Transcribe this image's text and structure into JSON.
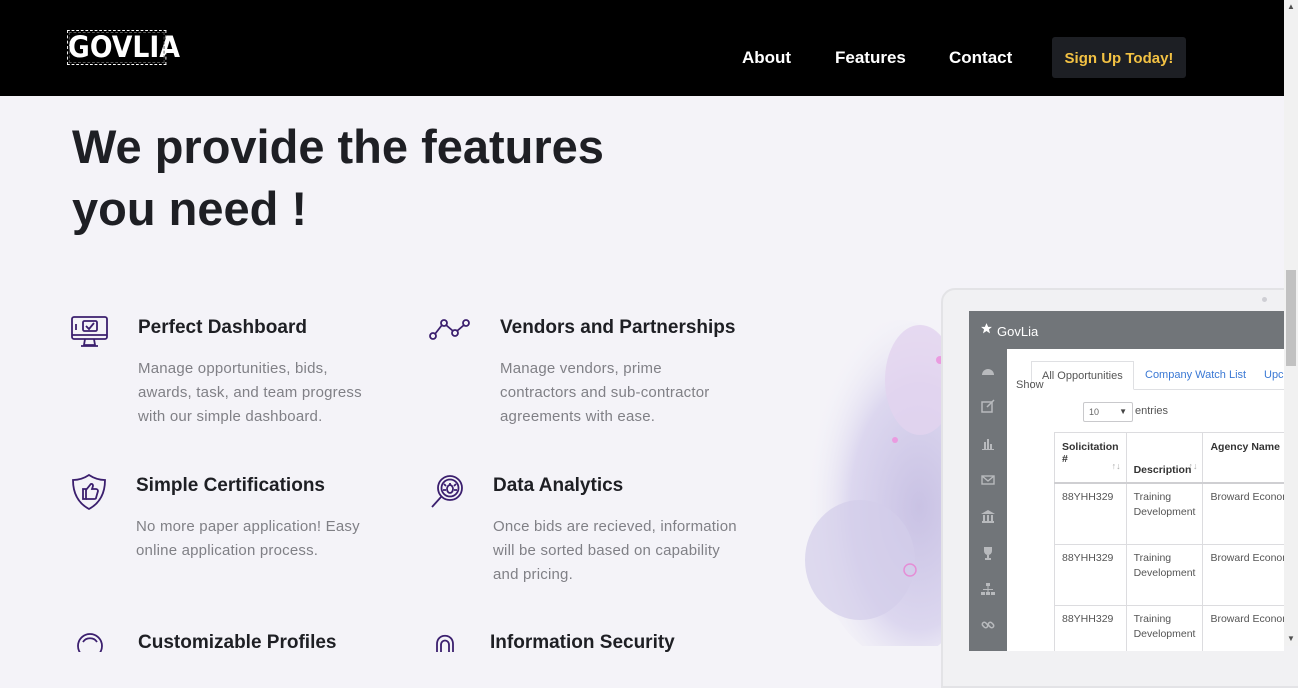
{
  "header": {
    "logo": "GOVLIA",
    "nav": {
      "about": "About",
      "features": "Features",
      "contact": "Contact"
    },
    "cta": "Sign Up Today!",
    "colors": {
      "background": "#000000",
      "cta_text": "#f2c143",
      "cta_bg": "#1d1f24"
    }
  },
  "hero": {
    "title": "We provide the features you need !"
  },
  "features": [
    {
      "icon": "monitor-check-icon",
      "title": "Perfect Dashboard",
      "desc": "Manage opportunities, bids, awards, task, and team progress with our simple dashboard."
    },
    {
      "icon": "network-nodes-icon",
      "title": "Vendors and Partnerships",
      "desc": "Manage vendors, prime contractors and sub-contractor agreements with ease."
    },
    {
      "icon": "shield-thumbs-up-icon",
      "title": "Simple Certifications",
      "desc": "No more paper application! Easy online application process."
    },
    {
      "icon": "magnifier-bug-icon",
      "title": "Data Analytics",
      "desc": "Once bids are recieved, information will be sorted based on capability and pricing."
    },
    {
      "icon": "profile-avatar-icon",
      "title": "Customizable Profiles"
    },
    {
      "icon": "lock-icon",
      "title": "Information Security"
    }
  ],
  "accent_color": "#3b1f6e",
  "mockup": {
    "app_name": "GovLia",
    "tabs": [
      "All Opportunities",
      "Company Watch List",
      "Upco"
    ],
    "show_label": "Show",
    "entries_value": "10",
    "entries_label": "entries",
    "columns": [
      "Solicitation #",
      "Description",
      "Agency Name"
    ],
    "rows": [
      [
        "88YHH329",
        "Training Development",
        "Broward Economic Opportun"
      ],
      [
        "88YHH329",
        "Training Development",
        "Broward Economic Opportun"
      ],
      [
        "88YHH329",
        "Training Development",
        "Broward Economic"
      ]
    ],
    "sidebar_icons": [
      "dashboard-icon",
      "edit-icon",
      "bar-chart-icon",
      "mail-icon",
      "bank-icon",
      "trophy-icon",
      "sitemap-icon",
      "link-icon"
    ]
  }
}
